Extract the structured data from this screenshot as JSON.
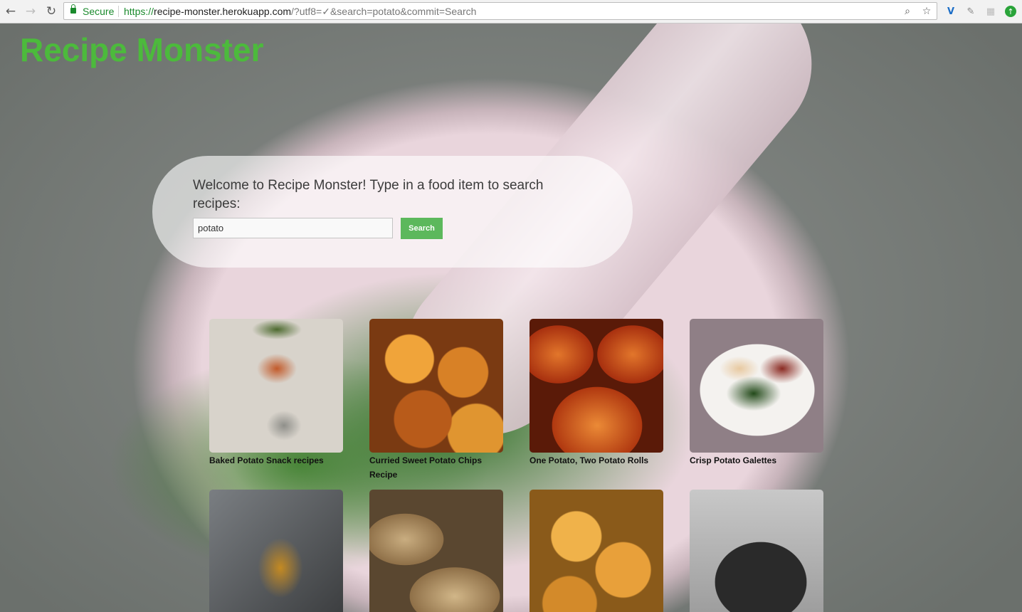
{
  "browser": {
    "secure_label": "Secure",
    "url_scheme": "https://",
    "url_host": "recipe-monster.herokuapp.com",
    "url_path": "/?utf8=✓&search=potato&commit=Search"
  },
  "site": {
    "title": "Recipe Monster",
    "welcome": "Welcome to Recipe Monster! Type in a food item to search recipes:",
    "search_value": "potato",
    "search_button": "Search"
  },
  "recipes": [
    {
      "title": "Baked Potato Snack recipes"
    },
    {
      "title": "Curried Sweet Potato Chips Recipe"
    },
    {
      "title": "One Potato, Two Potato Rolls"
    },
    {
      "title": "Crisp Potato Galettes"
    },
    {
      "title": ""
    },
    {
      "title": ""
    },
    {
      "title": ""
    },
    {
      "title": ""
    }
  ],
  "colors": {
    "brand_green": "#4cba3c",
    "button_green": "#5cb85c"
  }
}
